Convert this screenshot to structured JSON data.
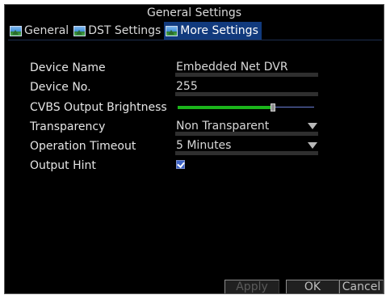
{
  "window": {
    "title": "General Settings"
  },
  "tabs": [
    {
      "label": "General",
      "icon": "picture-icon",
      "active": false
    },
    {
      "label": "DST Settings",
      "icon": "picture-icon",
      "active": false
    },
    {
      "label": "More Settings",
      "icon": "picture-icon",
      "active": true
    }
  ],
  "fields": {
    "device_name": {
      "label": "Device Name",
      "value": "Embedded Net DVR"
    },
    "device_no": {
      "label": "Device No.",
      "value": "255"
    },
    "cvbs_brightness": {
      "label": "CVBS Output Brightness",
      "level": 0.7
    },
    "transparency": {
      "label": "Transparency",
      "value": "Non Transparent"
    },
    "operation_timeout": {
      "label": "Operation Timeout",
      "value": "5 Minutes"
    },
    "output_hint": {
      "label": "Output Hint",
      "checked": true
    }
  },
  "buttons": {
    "apply": "Apply",
    "ok": "OK",
    "cancel": "Cancel"
  },
  "colors": {
    "background": "#000000",
    "active_tab": "#113a7d",
    "slider_fill": "#1bb51b",
    "slider_track": "#6b7fd6",
    "checkbox": "#3e64c8"
  }
}
